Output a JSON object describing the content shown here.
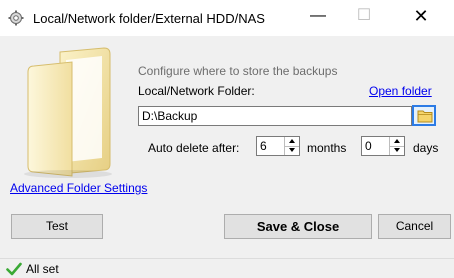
{
  "window": {
    "title": "Local/Network folder/External HDD/NAS",
    "minimize_glyph": "—",
    "maximize_glyph": "☐",
    "close_glyph": "✕",
    "app_icon": "gear-icon"
  },
  "form": {
    "hint": "Configure where to store the backups",
    "folder_label": "Local/Network Folder:",
    "open_folder_link": "Open folder",
    "path_value": "D:\\Backup",
    "browse_icon": "folder-icon",
    "auto_delete_label": "Auto delete after:",
    "months_value": "6",
    "months_label": "months",
    "days_value": "0",
    "days_label": "days",
    "advanced_link": "Advanced Folder Settings"
  },
  "buttons": {
    "test": "Test",
    "save_close": "Save & Close",
    "cancel": "Cancel"
  },
  "status": {
    "icon": "checkmark-icon",
    "text": "All set",
    "accent_color": "#3aa935"
  },
  "colors": {
    "link": "#0000ee",
    "focus_border": "#2c7be5"
  }
}
